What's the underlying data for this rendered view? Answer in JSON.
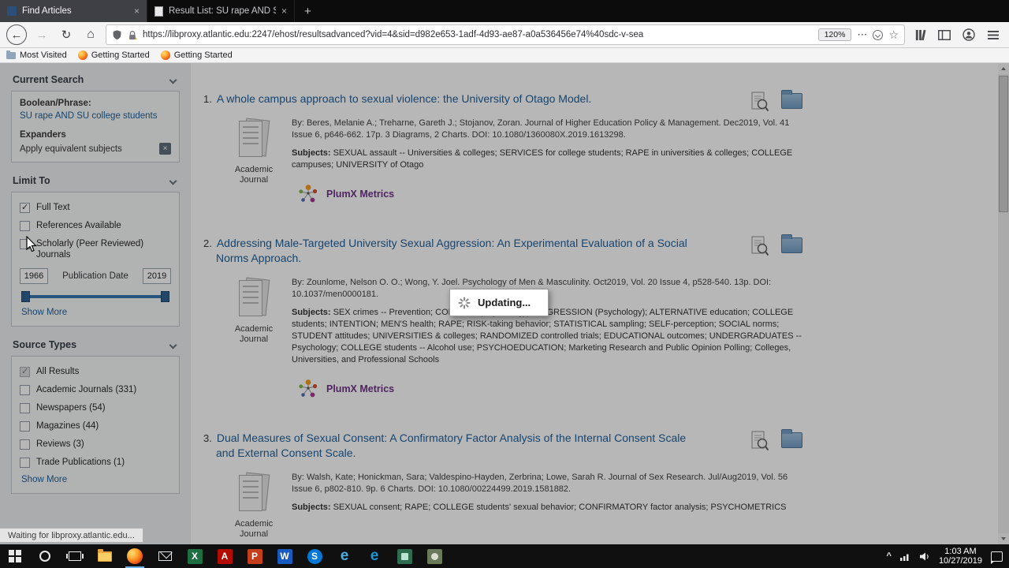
{
  "browser": {
    "tabs": [
      {
        "title": "Find Articles",
        "active": true
      },
      {
        "title": "Result List: SU rape AND SU co",
        "active": false
      }
    ],
    "nav": {
      "url": "https://libproxy.atlantic.edu:2247/ehost/resultsadvanced?vid=4&sid=d982e653-1adf-4d93-ae87-a0a536456e74%40sdc-v-sea",
      "zoom_badge": "120%"
    },
    "bookmarks": [
      {
        "label": "Most Visited"
      },
      {
        "label": "Getting Started"
      },
      {
        "label": "Getting Started"
      }
    ],
    "status_text": "Waiting for libproxy.atlantic.edu..."
  },
  "page": {
    "current_search": {
      "title": "Current Search",
      "boolean_label": "Boolean/Phrase:",
      "query_link": "SU rape AND SU college students",
      "expanders_label": "Expanders",
      "expander_name": "Apply equivalent subjects"
    },
    "limit_to": {
      "title": "Limit To",
      "options": [
        {
          "label": "Full Text",
          "checked": true
        },
        {
          "label": "References Available",
          "checked": false
        },
        {
          "label": "Scholarly (Peer Reviewed) Journals",
          "checked": false
        }
      ],
      "from_year": "1966",
      "slider_label": "Publication Date",
      "to_year": "2019",
      "show_more": "Show More"
    },
    "source_types": {
      "title": "Source Types",
      "options": [
        {
          "label": "All Results",
          "checked": true,
          "disabled": true
        },
        {
          "label": "Academic Journals (331)",
          "checked": false
        },
        {
          "label": "Newspapers (54)",
          "checked": false
        },
        {
          "label": "Magazines (44)",
          "checked": false
        },
        {
          "label": "Reviews (3)",
          "checked": false
        },
        {
          "label": "Trade Publications (1)",
          "checked": false
        }
      ],
      "show_more": "Show More"
    },
    "results": [
      {
        "number": "1.",
        "title": "A whole campus approach to sexual violence: the University of Otago Model.",
        "source_type": "Academic Journal",
        "citation": "By: Beres, Melanie A.; Treharne, Gareth J.; Stojanov, Zoran. Journal of Higher Education Policy & Management. Dec2019, Vol. 41 Issue 6, p646-662. 17p. 3 Diagrams, 2 Charts. DOI: 10.1080/1360080X.2019.1613298.",
        "subjects_label": "Subjects:",
        "subjects": "SEXUAL assault -- Universities & colleges; SERVICES for college students; RAPE in universities & colleges; COLLEGE campuses; UNIVERSITY of Otago",
        "plumx_label": "PlumX Metrics"
      },
      {
        "number": "2.",
        "title": "Addressing Male-Targeted University Sexual Aggression: An Experimental Evaluation of a Social Norms Approach.",
        "source_type": "Academic Journal",
        "citation": "By: Zounlome, Nelson O. O.; Wong, Y. Joel. Psychology of Men & Masculinity. Oct2019, Vol. 20 Issue 4, p528-540. 13p. DOI: 10.1037/men0000181.",
        "subjects_label": "Subjects:",
        "subjects": "SEX crimes -- Prevention; CONTROL (Psychology); AGGRESSION (Psychology); ALTERNATIVE education; COLLEGE students; INTENTION; MEN'S health; RAPE; RISK-taking behavior; STATISTICAL sampling; SELF-perception; SOCIAL norms; STUDENT attitudes; UNIVERSITIES & colleges; RANDOMIZED controlled trials; EDUCATIONAL outcomes; UNDERGRADUATES -- Psychology; COLLEGE students -- Alcohol use; PSYCHOEDUCATION; Marketing Research and Public Opinion Polling; Colleges, Universities, and Professional Schools",
        "plumx_label": "PlumX Metrics"
      },
      {
        "number": "3.",
        "title": "Dual Measures of Sexual Consent: A Confirmatory Factor Analysis of the Internal Consent Scale and External Consent Scale.",
        "source_type": "Academic Journal",
        "citation": "By: Walsh, Kate; Honickman, Sara; Valdespino-Hayden, Zerbrina; Lowe, Sarah R. Journal of Sex Research. Jul/Aug2019, Vol. 56 Issue 6, p802-810. 9p. 6 Charts. DOI: 10.1080/00224499.2019.1581882.",
        "subjects_label": "Subjects:",
        "subjects": "SEXUAL consent; RAPE; COLLEGE students' sexual behavior; CONFIRMATORY factor analysis; PSYCHOMETRICS"
      }
    ],
    "updating_modal": "Updating..."
  },
  "taskbar": {
    "icons": [
      "start",
      "search",
      "task-view",
      "file-explorer",
      "firefox",
      "mail",
      "excel",
      "acrobat",
      "powerpoint",
      "word",
      "skype",
      "internet-explorer",
      "edge",
      "app-1",
      "app-2"
    ],
    "tray_icons": [
      "chevron-up",
      "action-center"
    ],
    "time": "1:03 AM",
    "date": "10/27/2019"
  }
}
